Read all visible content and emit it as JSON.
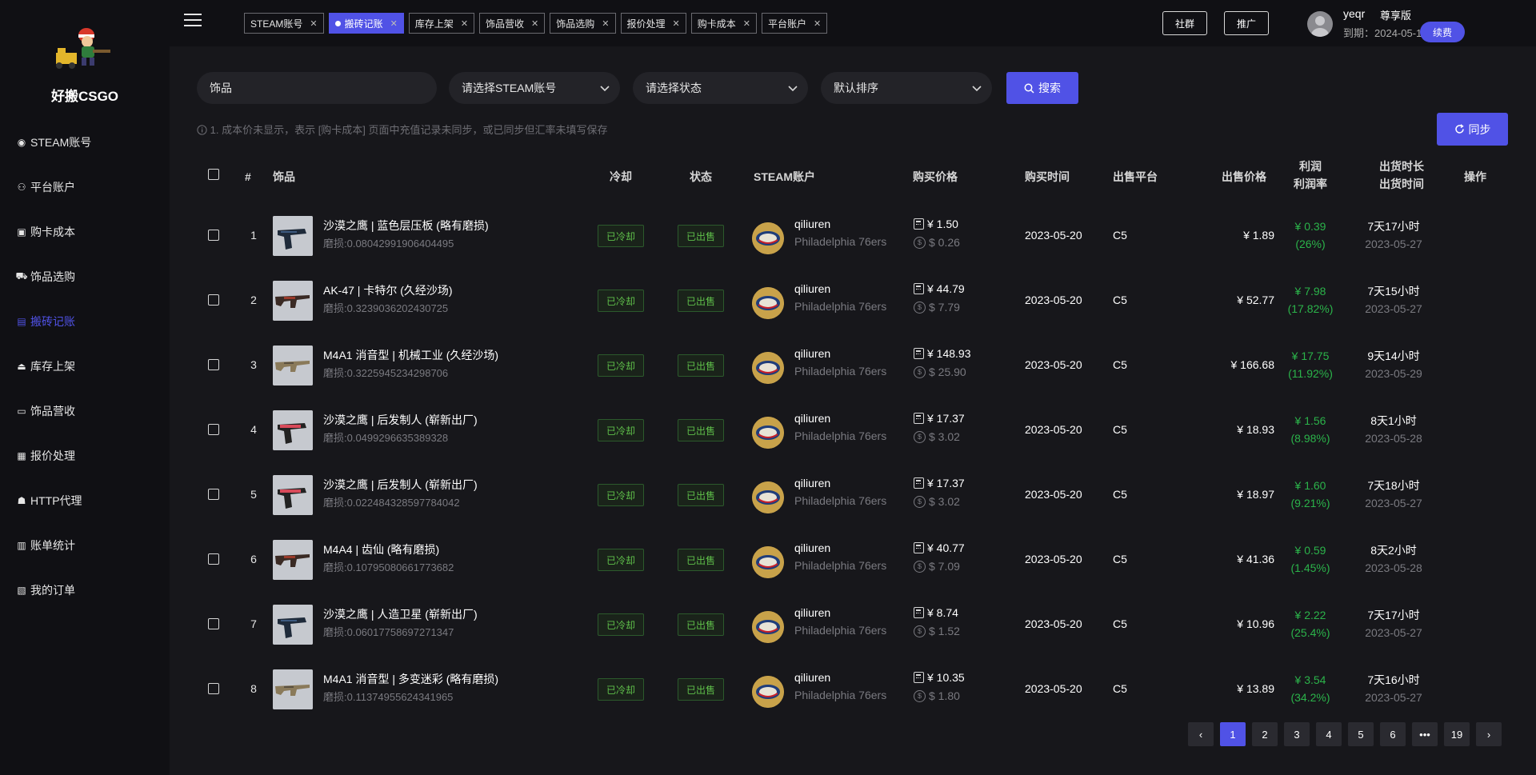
{
  "app": {
    "brand": "好搬CSGO",
    "colors": {
      "accent": "#5052e6",
      "profit": "#2bb34a",
      "tag_green": "#5fbf4a"
    }
  },
  "sidebar": {
    "items": [
      {
        "label": "STEAM账号",
        "icon": "steam-icon"
      },
      {
        "label": "平台账户",
        "icon": "users-icon"
      },
      {
        "label": "购卡成本",
        "icon": "card-icon"
      },
      {
        "label": "饰品选购",
        "icon": "cart-icon"
      },
      {
        "label": "搬砖记账",
        "icon": "book-icon",
        "active": true
      },
      {
        "label": "库存上架",
        "icon": "upload-icon"
      },
      {
        "label": "饰品营收",
        "icon": "wallet-icon"
      },
      {
        "label": "报价处理",
        "icon": "quote-icon"
      },
      {
        "label": "HTTP代理",
        "icon": "proxy-icon"
      },
      {
        "label": "账单统计",
        "icon": "chart-icon"
      },
      {
        "label": "我的订单",
        "icon": "order-icon"
      }
    ]
  },
  "header": {
    "tabs": [
      {
        "label": "STEAM账号"
      },
      {
        "label": "搬砖记账",
        "active": true
      },
      {
        "label": "库存上架"
      },
      {
        "label": "饰品营收"
      },
      {
        "label": "饰品选购"
      },
      {
        "label": "报价处理"
      },
      {
        "label": "购卡成本"
      },
      {
        "label": "平台账户"
      }
    ],
    "community": "社群",
    "promote": "推广",
    "user": {
      "name": "yeqr",
      "level": "尊享版",
      "expiry": "到期：2024-05-17",
      "renew": "续费"
    }
  },
  "filters": {
    "item_value": "饰品",
    "account": "请选择STEAM账号",
    "status": "请选择状态",
    "sort": "默认排序",
    "search": "搜索",
    "sync": "同步",
    "notice": "1. 成本价未显示，表示 [购卡成本] 页面中充值记录未同步，或已同步但汇率未填写保存"
  },
  "table": {
    "headers": {
      "num": "#",
      "item": "饰品",
      "cooldown": "冷却",
      "status": "状态",
      "account": "STEAM账户",
      "buy_price": "购买价格",
      "buy_time": "购买时间",
      "platform": "出售平台",
      "sell_price": "出售价格",
      "profit": "利润",
      "profit_rate": "利润率",
      "duration": "出货时长",
      "sell_time": "出货时间",
      "action": "操作"
    },
    "rows": [
      {
        "num": "1",
        "name": "沙漠之鹰 | 蓝色层压板 (略有磨损)",
        "wear": "磨损:0.08042991906404495",
        "cooldown": "已冷却",
        "status": "已出售",
        "account": "qiliuren",
        "team": "Philadelphia 76ers",
        "cny": "¥ 1.50",
        "usd": "$ 0.26",
        "date": "2023-05-20",
        "platform": "C5",
        "sell": "¥ 1.89",
        "profit": "¥ 0.39",
        "rate": "(26%)",
        "duration": "7天17小时",
        "sell_date": "2023-05-27",
        "weapon": "pistol"
      },
      {
        "num": "2",
        "name": "AK-47 | 卡特尔 (久经沙场)",
        "wear": "磨损:0.3239036202430725",
        "cooldown": "已冷却",
        "status": "已出售",
        "account": "qiliuren",
        "team": "Philadelphia 76ers",
        "cny": "¥ 44.79",
        "usd": "$ 7.79",
        "date": "2023-05-20",
        "platform": "C5",
        "sell": "¥ 52.77",
        "profit": "¥ 7.98",
        "rate": "(17.82%)",
        "duration": "7天15小时",
        "sell_date": "2023-05-27",
        "weapon": "rifle"
      },
      {
        "num": "3",
        "name": "M4A1 消音型 | 机械工业 (久经沙场)",
        "wear": "磨损:0.3225945234298706",
        "cooldown": "已冷却",
        "status": "已出售",
        "account": "qiliuren",
        "team": "Philadelphia 76ers",
        "cny": "¥ 148.93",
        "usd": "$ 25.90",
        "date": "2023-05-20",
        "platform": "C5",
        "sell": "¥ 166.68",
        "profit": "¥ 17.75",
        "rate": "(11.92%)",
        "duration": "9天14小时",
        "sell_date": "2023-05-29",
        "weapon": "rifle-light"
      },
      {
        "num": "4",
        "name": "沙漠之鹰 | 后发制人 (崭新出厂)",
        "wear": "磨损:0.0499296635389328",
        "cooldown": "已冷却",
        "status": "已出售",
        "account": "qiliuren",
        "team": "Philadelphia 76ers",
        "cny": "¥ 17.37",
        "usd": "$ 3.02",
        "date": "2023-05-20",
        "platform": "C5",
        "sell": "¥ 18.93",
        "profit": "¥ 1.56",
        "rate": "(8.98%)",
        "duration": "8天1小时",
        "sell_date": "2023-05-28",
        "weapon": "pistol-red"
      },
      {
        "num": "5",
        "name": "沙漠之鹰 | 后发制人 (崭新出厂)",
        "wear": "磨损:0.022484328597784042",
        "cooldown": "已冷却",
        "status": "已出售",
        "account": "qiliuren",
        "team": "Philadelphia 76ers",
        "cny": "¥ 17.37",
        "usd": "$ 3.02",
        "date": "2023-05-20",
        "platform": "C5",
        "sell": "¥ 18.97",
        "profit": "¥ 1.60",
        "rate": "(9.21%)",
        "duration": "7天18小时",
        "sell_date": "2023-05-27",
        "weapon": "pistol-red"
      },
      {
        "num": "6",
        "name": "M4A4 | 齿仙 (略有磨损)",
        "wear": "磨损:0.10795080661773682",
        "cooldown": "已冷却",
        "status": "已出售",
        "account": "qiliuren",
        "team": "Philadelphia 76ers",
        "cny": "¥ 40.77",
        "usd": "$ 7.09",
        "date": "2023-05-20",
        "platform": "C5",
        "sell": "¥ 41.36",
        "profit": "¥ 0.59",
        "rate": "(1.45%)",
        "duration": "8天2小时",
        "sell_date": "2023-05-28",
        "weapon": "rifle"
      },
      {
        "num": "7",
        "name": "沙漠之鹰 | 人造卫星 (崭新出厂)",
        "wear": "磨损:0.06017758697271347",
        "cooldown": "已冷却",
        "status": "已出售",
        "account": "qiliuren",
        "team": "Philadelphia 76ers",
        "cny": "¥ 8.74",
        "usd": "$ 1.52",
        "date": "2023-05-20",
        "platform": "C5",
        "sell": "¥ 10.96",
        "profit": "¥ 2.22",
        "rate": "(25.4%)",
        "duration": "7天17小时",
        "sell_date": "2023-05-27",
        "weapon": "pistol"
      },
      {
        "num": "8",
        "name": "M4A1 消音型 | 多变迷彩 (略有磨损)",
        "wear": "磨损:0.11374955624341965",
        "cooldown": "已冷却",
        "status": "已出售",
        "account": "qiliuren",
        "team": "Philadelphia 76ers",
        "cny": "¥ 10.35",
        "usd": "$ 1.80",
        "date": "2023-05-20",
        "platform": "C5",
        "sell": "¥ 13.89",
        "profit": "¥ 3.54",
        "rate": "(34.2%)",
        "duration": "7天16小时",
        "sell_date": "2023-05-27",
        "weapon": "rifle-light"
      }
    ]
  },
  "pagination": {
    "prev": "‹",
    "pages": [
      "1",
      "2",
      "3",
      "4",
      "5",
      "6"
    ],
    "ellipsis": "•••",
    "last": "19",
    "next": "›",
    "current": "1"
  }
}
